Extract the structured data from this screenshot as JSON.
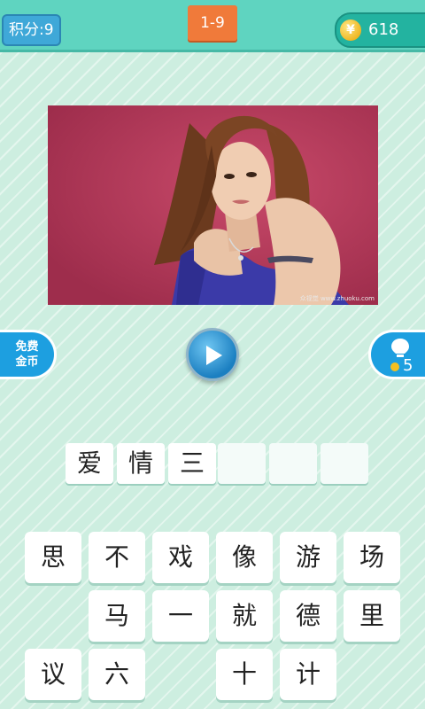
{
  "header": {
    "score_label": "积分:9",
    "level": "1-9",
    "coin_icon_glyph": "¥",
    "coins": "618"
  },
  "photo": {
    "watermark": "众视觉 www.zhuoku.com"
  },
  "actions": {
    "free_coins_line1": "免费",
    "free_coins_line2": "金币",
    "hint_cost": "5"
  },
  "answer": {
    "slots": [
      "爱",
      "情",
      "三",
      "",
      "",
      ""
    ]
  },
  "choices": {
    "row1": [
      "思",
      "不",
      "戏",
      "像",
      "游",
      "场"
    ],
    "row2": [
      "马",
      "一",
      "就",
      "德",
      "里"
    ],
    "row3": [
      "议",
      "六",
      "十",
      "计"
    ]
  },
  "colors": {
    "background": "#cdeee0",
    "header": "#5fd4c0",
    "level_badge": "#f07a3a",
    "score_badge": "#3fa8d8",
    "side_buttons": "#1d9fe0",
    "photo_background": "#b43d5c"
  }
}
